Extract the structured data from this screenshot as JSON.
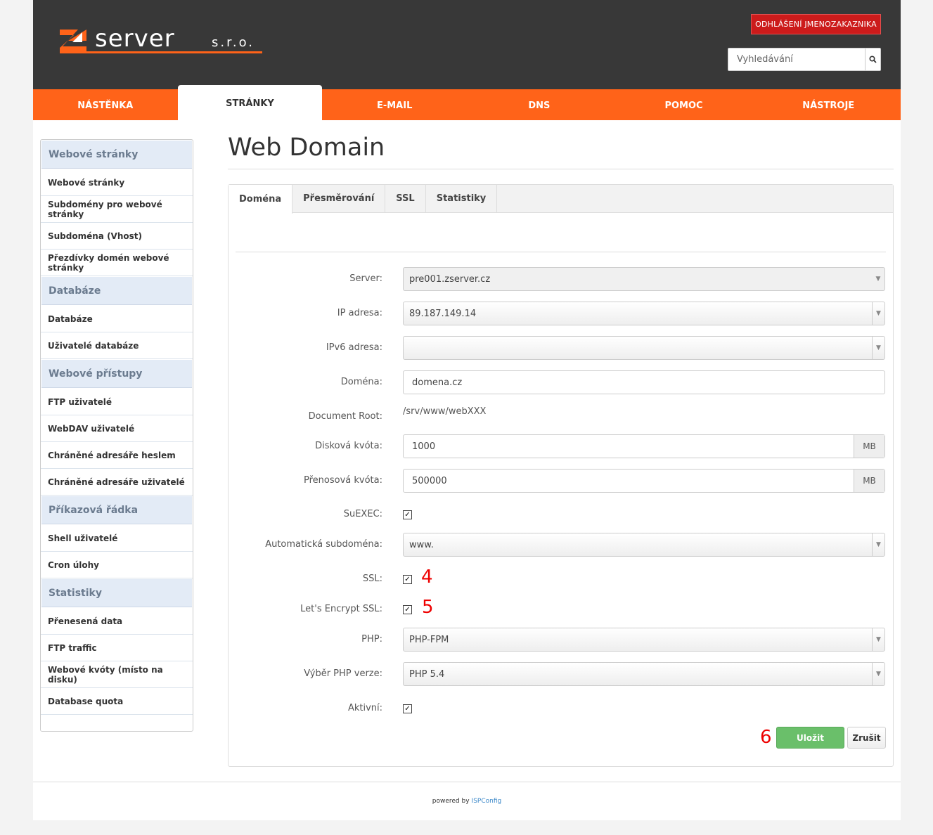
{
  "header": {
    "logo_text": "server",
    "logo_suffix": "s.r.o.",
    "logout_label": "ODHLÁŠENÍ JMENOZAKAZNIKA",
    "search_placeholder": "Vyhledávání",
    "search_icon": "search-icon"
  },
  "nav": {
    "items": [
      {
        "label": "NÁSTĚNKA",
        "active": false
      },
      {
        "label": "STRÁNKY",
        "active": true
      },
      {
        "label": "E-MAIL",
        "active": false
      },
      {
        "label": "DNS",
        "active": false
      },
      {
        "label": "POMOC",
        "active": false
      },
      {
        "label": "NÁSTROJE",
        "active": false
      }
    ]
  },
  "sidebar": {
    "groups": [
      {
        "title": "Webové stránky",
        "items": [
          "Webové stránky",
          "Subdomény pro webové stránky",
          "Subdoména (Vhost)",
          "Přezdívky domén webové stránky"
        ]
      },
      {
        "title": "Databáze",
        "items": [
          "Databáze",
          "Uživatelé databáze"
        ]
      },
      {
        "title": "Webové přístupy",
        "items": [
          "FTP uživatelé",
          "WebDAV uživatelé",
          "Chráněné adresáře heslem",
          "Chráněné adresáře uživatelé"
        ]
      },
      {
        "title": "Příkazová řádka",
        "items": [
          "Shell uživatelé",
          "Cron úlohy"
        ]
      },
      {
        "title": "Statistiky",
        "items": [
          "Přenesená data",
          "FTP traffic",
          "Webové kvóty (místo na disku)",
          "Database quota"
        ]
      }
    ]
  },
  "main": {
    "title": "Web Domain",
    "tabs": [
      "Doména",
      "Přesměrování",
      "SSL",
      "Statistiky"
    ],
    "form": {
      "server_label": "Server:",
      "server_value": "pre001.zserver.cz",
      "ip_label": "IP adresa:",
      "ip_value": "89.187.149.14",
      "ipv6_label": "IPv6 adresa:",
      "ipv6_value": "",
      "domain_label": "Doména:",
      "domain_value": "domena.cz",
      "docroot_label": "Document Root:",
      "docroot_value": "/srv/www/webXXX",
      "disk_label": "Disková kvóta:",
      "disk_value": "1000",
      "disk_unit": "MB",
      "traffic_label": "Přenosová kvóta:",
      "traffic_value": "500000",
      "traffic_unit": "MB",
      "suexec_label": "SuEXEC:",
      "suexec_checked": true,
      "autosub_label": "Automatická subdoména:",
      "autosub_value": "www.",
      "ssl_label": "SSL:",
      "ssl_checked": true,
      "le_label": "Let's Encrypt SSL:",
      "le_checked": true,
      "php_label": "PHP:",
      "php_value": "PHP-FPM",
      "phpver_label": "Výběr PHP verze:",
      "phpver_value": "PHP 5.4",
      "active_label": "Aktivní:",
      "active_checked": true
    },
    "annotations": {
      "ssl": "4",
      "le": "5",
      "save": "6"
    },
    "save_label": "Uložit",
    "cancel_label": "Zrušit"
  },
  "footer": {
    "text": "powered by",
    "link": "ISPConfig"
  },
  "colors": {
    "header_bg": "#383838",
    "nav_accent": "#ff6319",
    "logout_red": "#cc1b1b",
    "save_green": "#6abf6a",
    "annotation_red": "#e00000"
  }
}
